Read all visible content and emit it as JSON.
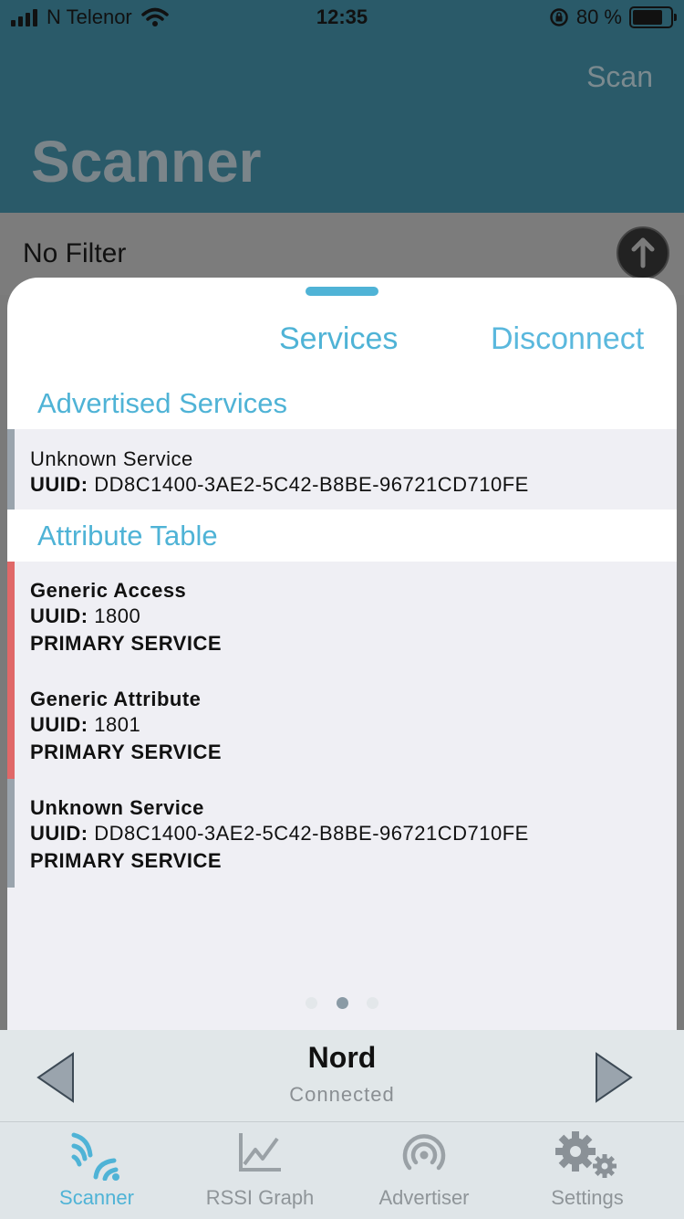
{
  "status_bar": {
    "carrier": "N Telenor",
    "time": "12:35",
    "battery_text": "80 %"
  },
  "header": {
    "scan_label": "Scan",
    "title": "Scanner"
  },
  "filter": {
    "label": "No Filter"
  },
  "sheet": {
    "tabs": {
      "services": "Services",
      "disconnect": "Disconnect"
    },
    "advertised_title": "Advertised Services",
    "advertised": [
      {
        "name": "Unknown Service",
        "uuid_label": "UUID:",
        "uuid": "DD8C1400-3AE2-5C42-B8BE-96721CD710FE",
        "bar_color": "#9aa4ad"
      }
    ],
    "attribute_title": "Attribute Table",
    "attributes": [
      {
        "name": "Generic Access",
        "uuid_label": "UUID:",
        "uuid": "1800",
        "kind": "PRIMARY SERVICE",
        "bar_color": "#e06868"
      },
      {
        "name": "Generic Attribute",
        "uuid_label": "UUID:",
        "uuid": "1801",
        "kind": "PRIMARY SERVICE",
        "bar_color": "#e06868"
      },
      {
        "name": "Unknown Service",
        "uuid_label": "UUID:",
        "uuid": "DD8C1400-3AE2-5C42-B8BE-96721CD710FE",
        "kind": "PRIMARY SERVICE",
        "bar_color": "#9aa4ad"
      }
    ],
    "page_index": 2,
    "page_count": 3
  },
  "device": {
    "name": "Nord",
    "status": "Connected"
  },
  "tabbar": {
    "tabs": [
      {
        "label": "Scanner",
        "icon": "scanner-icon",
        "active": true
      },
      {
        "label": "RSSI Graph",
        "icon": "graph-icon",
        "active": false
      },
      {
        "label": "Advertiser",
        "icon": "advertiser-icon",
        "active": false
      },
      {
        "label": "Settings",
        "icon": "settings-icon",
        "active": false
      }
    ]
  },
  "colors": {
    "accent": "#4fb3d6",
    "header_bg": "#2a5a69",
    "row_bg": "#efeff4"
  }
}
